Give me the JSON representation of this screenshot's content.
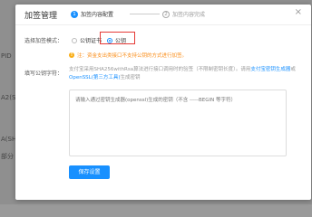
{
  "background": {
    "labels": [
      "PID",
      "A2(SH",
      "A(SH",
      "部分"
    ]
  },
  "modal": {
    "title": "加签管理",
    "steps": [
      {
        "num": "1",
        "label": "加签内容配置"
      },
      {
        "num": "2",
        "label": "加签内容完成"
      }
    ],
    "close_icon": "×",
    "mode_label": "选择加签模式：",
    "mode_options": [
      "公钥证书",
      "公钥"
    ],
    "mode_selected": "公钥",
    "warning_icon": "!",
    "warning_text": "注：资金支出类接口不支持公钥的方式进行加签。",
    "key_label": "填写公钥字符：",
    "hint_part1": "支付宝采用SHA256withRsa算法进行接口调用时的验签（不限制密钥长度）。请用",
    "hint_link1": "支付宝密钥生成器",
    "hint_part2": "或",
    "hint_link2": "OpenSSL(第三方工具)",
    "hint_part3": "生成密钥",
    "textarea_placeholder": "请输入通过密钥生成器(openssl)生成的密钥（不含 -----BEGIN 等字符）",
    "save_label": "保存设置"
  },
  "colors": {
    "accent": "#1890ff",
    "warning": "#fa8c16",
    "highlight": "#e53935"
  }
}
